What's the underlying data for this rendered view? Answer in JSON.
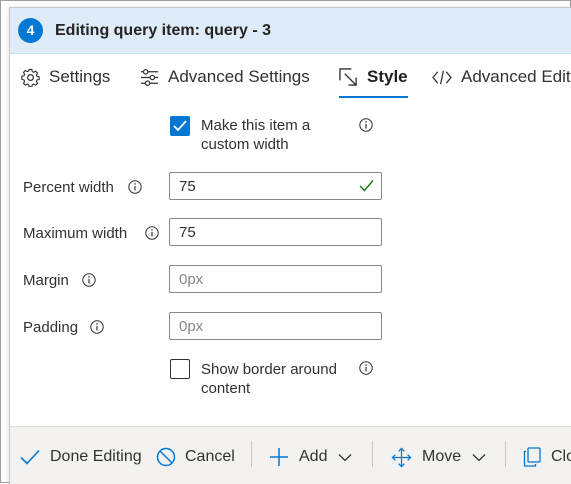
{
  "header": {
    "step_number": "4",
    "title": "Editing query item: query - 3"
  },
  "tabs": [
    {
      "label": "Settings",
      "icon": "gear-icon"
    },
    {
      "label": "Advanced Settings",
      "icon": "sliders-icon"
    },
    {
      "label": "Style",
      "icon": "resize-icon",
      "active": true
    },
    {
      "label": "Advanced Edito",
      "icon": "code-icon"
    }
  ],
  "form": {
    "custom_width": {
      "label": "Make this item a custom width",
      "checked": true
    },
    "percent_width": {
      "label": "Percent width",
      "value": "75"
    },
    "maximum_width": {
      "label": "Maximum width",
      "value": "75"
    },
    "margin": {
      "label": "Margin",
      "placeholder": "0px"
    },
    "padding": {
      "label": "Padding",
      "placeholder": "0px"
    },
    "show_border": {
      "label": "Show border around content",
      "checked": false
    }
  },
  "toolbar": {
    "done_label": "Done Editing",
    "cancel_label": "Cancel",
    "add_label": "Add",
    "move_label": "Move",
    "clone_label": "Clo"
  },
  "colors": {
    "accent": "#0078d4",
    "header_bg": "#deecf9",
    "toolbar_bg": "#f3f2f1",
    "valid_check": "#107c10"
  }
}
